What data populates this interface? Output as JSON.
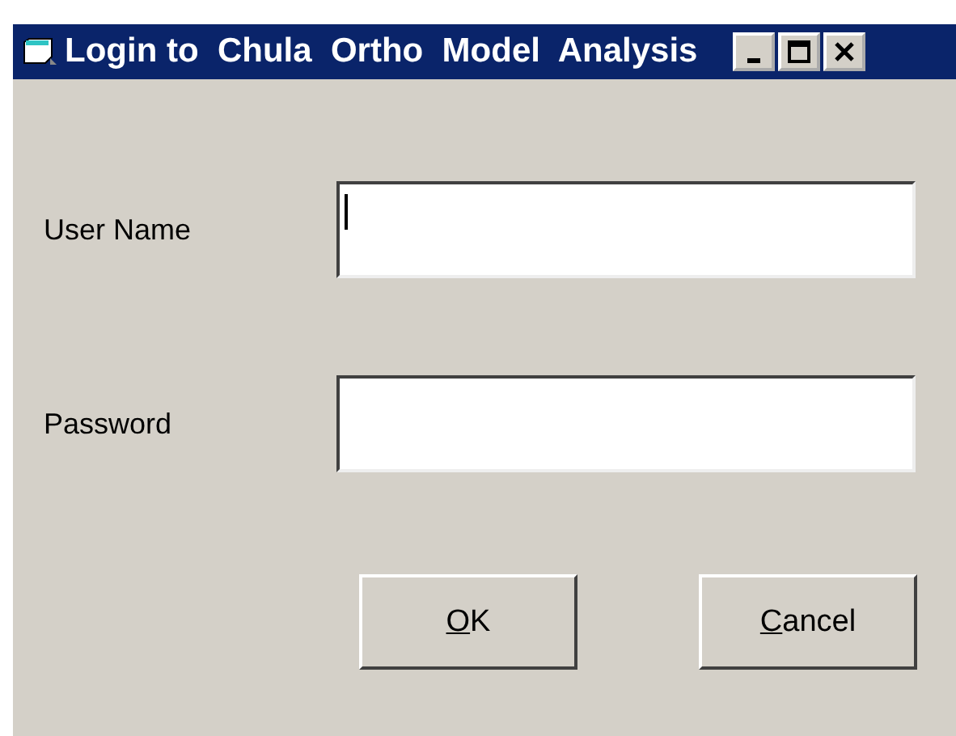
{
  "window": {
    "title": "Login to  Chula  Ortho  Model  Analysis"
  },
  "fields": [
    {
      "label": "User Name",
      "focused": true
    },
    {
      "label": "Password",
      "focused": false
    }
  ],
  "buttons": [
    "OK",
    "Cancel"
  ]
}
